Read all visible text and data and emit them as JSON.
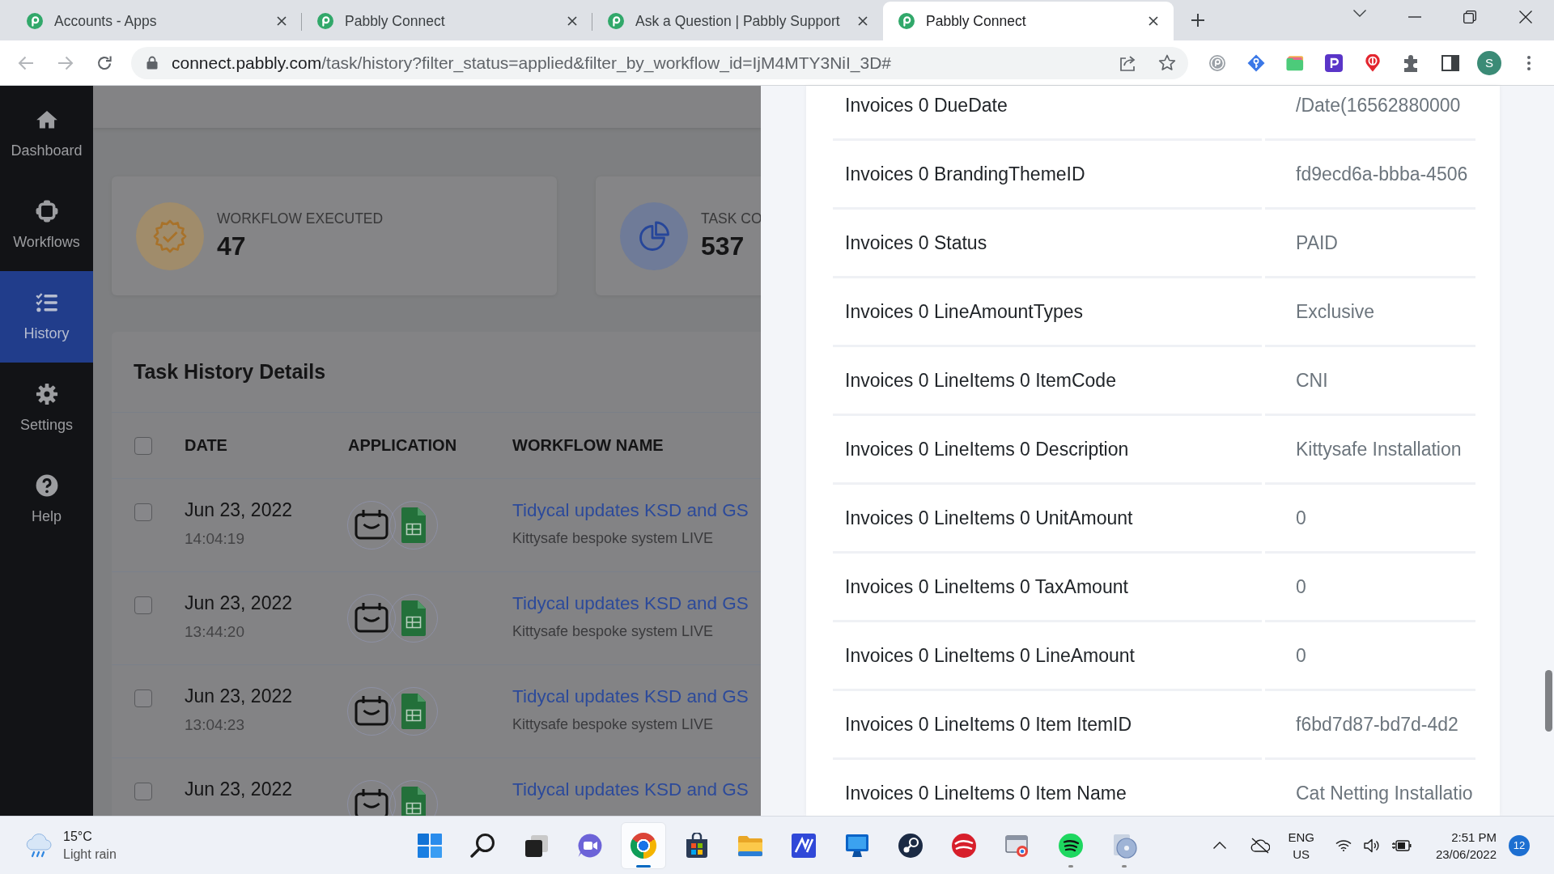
{
  "browser": {
    "tabs": [
      {
        "title": "Accounts - Apps",
        "selected": false
      },
      {
        "title": "Pabbly Connect",
        "selected": false
      },
      {
        "title": "Ask a Question | Pabbly Support",
        "selected": false
      },
      {
        "title": "Pabbly Connect",
        "selected": true
      }
    ],
    "back": {
      "disabled": true
    },
    "forward": {
      "disabled": true
    },
    "address": {
      "host": "connect.pabbly.com",
      "path": "/task/history?filter_status=applied&filter_by_workflow_id=IjM4MTY3NiI_3D#"
    },
    "profile_initial": "S"
  },
  "sidebar": {
    "items": [
      {
        "kind": "home",
        "label": "Dashboard",
        "selected": false
      },
      {
        "kind": "workflows",
        "label": "Workflows",
        "selected": false
      },
      {
        "kind": "history",
        "label": "History",
        "selected": true
      },
      {
        "kind": "settings",
        "label": "Settings",
        "selected": false
      },
      {
        "kind": "help",
        "label": "Help",
        "selected": false
      }
    ]
  },
  "stats": [
    {
      "kind": "executed",
      "label": "WORKFLOW EXECUTED",
      "value": "47"
    },
    {
      "kind": "tasks",
      "label": "TASK CO",
      "value": "537"
    }
  ],
  "task_history": {
    "title": "Task History Details",
    "select_all": {
      "checked": false
    },
    "columns": [
      "DATE",
      "APPLICATION",
      "WORKFLOW NAME"
    ],
    "rows": [
      {
        "checked": false,
        "date": "Jun 23, 2022",
        "time": "14:04:19",
        "workflow": "Tidycal updates KSD and GS",
        "subtitle": "Kittysafe bespoke system LIVE"
      },
      {
        "checked": false,
        "date": "Jun 23, 2022",
        "time": "13:44:20",
        "workflow": "Tidycal updates KSD and GS",
        "subtitle": "Kittysafe bespoke system LIVE"
      },
      {
        "checked": false,
        "date": "Jun 23, 2022",
        "time": "13:04:23",
        "workflow": "Tidycal updates KSD and GS",
        "subtitle": "Kittysafe bespoke system LIVE"
      },
      {
        "checked": false,
        "date": "Jun 23, 2022",
        "workflow": "Tidycal updates KSD and GS"
      }
    ]
  },
  "detail_panel": {
    "fields": [
      {
        "label": "Invoices 0 DueDate",
        "value": "/Date(16562880000"
      },
      {
        "label": "Invoices 0 BrandingThemeID",
        "value": "fd9ecd6a-bbba-4506"
      },
      {
        "label": "Invoices 0 Status",
        "value": "PAID"
      },
      {
        "label": "Invoices 0 LineAmountTypes",
        "value": "Exclusive"
      },
      {
        "label": "Invoices 0 LineItems 0 ItemCode",
        "value": "CNI"
      },
      {
        "label": "Invoices 0 LineItems 0 Description",
        "value": "Kittysafe Installation"
      },
      {
        "label": "Invoices 0 LineItems 0 UnitAmount",
        "value": "0"
      },
      {
        "label": "Invoices 0 LineItems 0 TaxAmount",
        "value": "0"
      },
      {
        "label": "Invoices 0 LineItems 0 LineAmount",
        "value": "0"
      },
      {
        "label": "Invoices 0 LineItems 0 Item ItemID",
        "value": "f6bd7d87-bd7d-4d2"
      },
      {
        "label": "Invoices 0 LineItems 0 Item Name",
        "value": "Cat Netting Installatio"
      }
    ]
  },
  "taskbar": {
    "weather": {
      "temperature": "15°C",
      "condition": "Light rain"
    },
    "apps": [
      {
        "kind": "start",
        "active": false,
        "running": false
      },
      {
        "kind": "search",
        "active": false,
        "running": false
      },
      {
        "kind": "taskview",
        "active": false,
        "running": false
      },
      {
        "kind": "chat",
        "active": false,
        "running": false
      },
      {
        "kind": "browser",
        "active": true,
        "running": true
      },
      {
        "kind": "store",
        "active": false,
        "running": false
      },
      {
        "kind": "explorer",
        "active": false,
        "running": false
      },
      {
        "kind": "editor",
        "active": false,
        "running": false
      },
      {
        "kind": "monitor",
        "active": false,
        "running": false
      },
      {
        "kind": "steam",
        "active": false,
        "running": false
      },
      {
        "kind": "antivirus",
        "active": false,
        "running": false
      },
      {
        "kind": "remote",
        "active": false,
        "running": false
      },
      {
        "kind": "music",
        "active": false,
        "running": true
      },
      {
        "kind": "disc",
        "active": false,
        "running": true
      }
    ],
    "language": "ENG",
    "region": "US",
    "time": "2:51 PM",
    "date": "23/06/2022",
    "notifications": "12"
  }
}
